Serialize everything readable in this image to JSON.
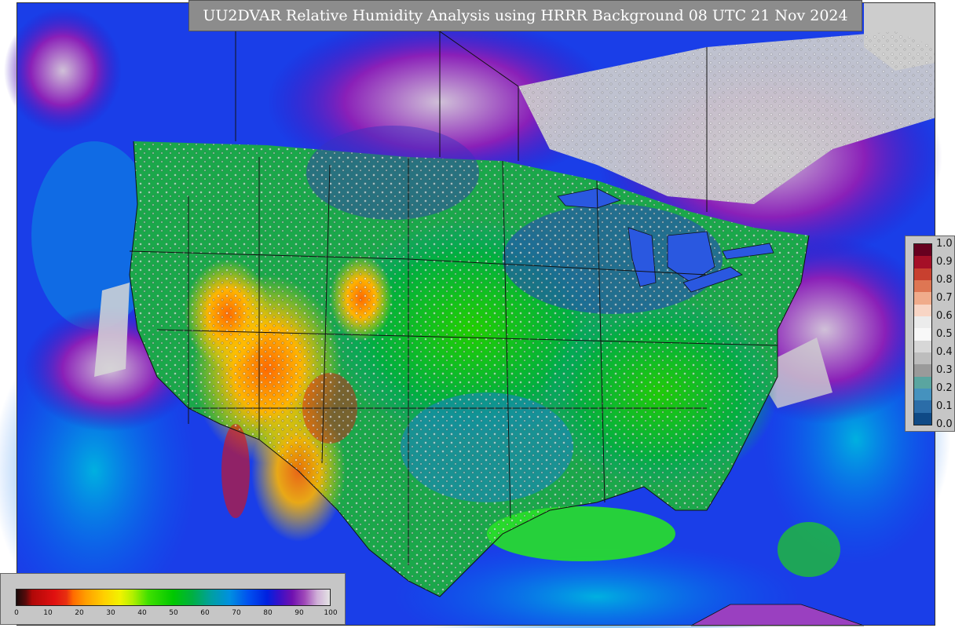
{
  "title": "UU2DVAR Relative Humidity Analysis using HRRR Background 08 UTC 21 Nov 2024",
  "colorbar_right": {
    "ticks": [
      "1.0",
      "0.9",
      "0.8",
      "0.7",
      "0.6",
      "0.5",
      "0.4",
      "0.3",
      "0.2",
      "0.1",
      "0.0"
    ],
    "colors": [
      "#67001f",
      "#a50f27",
      "#c8402f",
      "#de7653",
      "#f0ab8b",
      "#f8d5c5",
      "#ececec",
      "#f8f8f8",
      "#d7d7d7",
      "#bdbdbd",
      "#9a9a9a",
      "#5aa5a0",
      "#4592be",
      "#2b6da8",
      "#0f4a86"
    ]
  },
  "colorbar_bottom": {
    "ticks": [
      "0",
      "10",
      "20",
      "30",
      "40",
      "50",
      "60",
      "70",
      "80",
      "90",
      "100"
    ]
  },
  "legend_colors": {
    "dry": "#e83010",
    "mid": "#00c800",
    "moist": "#0020e0",
    "saturated": "#7010b0",
    "no_data": "#cfcfcf"
  }
}
